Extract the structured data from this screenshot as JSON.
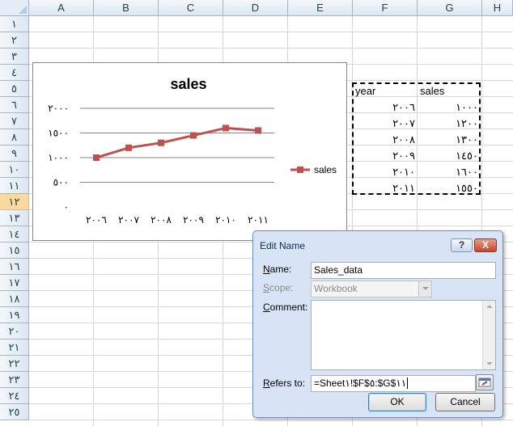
{
  "columns": [
    "A",
    "B",
    "C",
    "D",
    "E",
    "F",
    "G",
    "H"
  ],
  "rows": [
    "١",
    "٢",
    "٣",
    "٤",
    "٥",
    "٦",
    "٧",
    "٨",
    "٩",
    "١٠",
    "١١",
    "١٢",
    "١٣",
    "١٤",
    "١٥",
    "١٦",
    "١٧",
    "١٨",
    "١٩",
    "٢٠",
    "٢١",
    "٢٢",
    "٢٣",
    "٢٤",
    "٢٥"
  ],
  "selected_row": "١٢",
  "table": {
    "headers": {
      "year": "year",
      "sales": "sales"
    },
    "rows": [
      {
        "year": "٢٠٠٦",
        "sales": "١٠٠٠"
      },
      {
        "year": "٢٠٠٧",
        "sales": "١٢٠٠"
      },
      {
        "year": "٢٠٠٨",
        "sales": "١٣٠٠"
      },
      {
        "year": "٢٠٠٩",
        "sales": "١٤٥٠"
      },
      {
        "year": "٢٠١٠",
        "sales": "١٦٠٠"
      },
      {
        "year": "٢٠١١",
        "sales": "١٥٥٠"
      }
    ]
  },
  "chart_data": {
    "type": "line",
    "title": "sales",
    "categories": [
      "٢٠٠٦",
      "٢٠٠٧",
      "٢٠٠٨",
      "٢٠٠٩",
      "٢٠١٠",
      "٢٠١١"
    ],
    "series": [
      {
        "name": "sales",
        "values": [
          1000,
          1200,
          1300,
          1450,
          1600,
          1550
        ],
        "color": "#c0504d"
      }
    ],
    "y_ticks": [
      {
        "value": 0,
        "label": "٠"
      },
      {
        "value": 500,
        "label": "٥٠٠"
      },
      {
        "value": 1000,
        "label": "١٠٠٠"
      },
      {
        "value": 1500,
        "label": "١٥٠٠"
      },
      {
        "value": 2000,
        "label": "٢٠٠٠"
      }
    ],
    "ylim": [
      0,
      2000
    ],
    "grid": true,
    "legend": "right"
  },
  "dialog": {
    "title": "Edit Name",
    "help_label": "?",
    "close_label": "X",
    "name_label_key": "N",
    "name_label_rest": "ame:",
    "name_value": "Sales_data",
    "scope_label_key": "S",
    "scope_label_rest": "cope:",
    "scope_value": "Workbook",
    "comment_label_key": "C",
    "comment_label_rest": "omment:",
    "comment_value": "",
    "refers_label_key": "R",
    "refers_label_rest": "efers to:",
    "refers_value": "=Sheet١!$F$٥:$G$١١",
    "ok_label": "OK",
    "cancel_label": "Cancel"
  }
}
